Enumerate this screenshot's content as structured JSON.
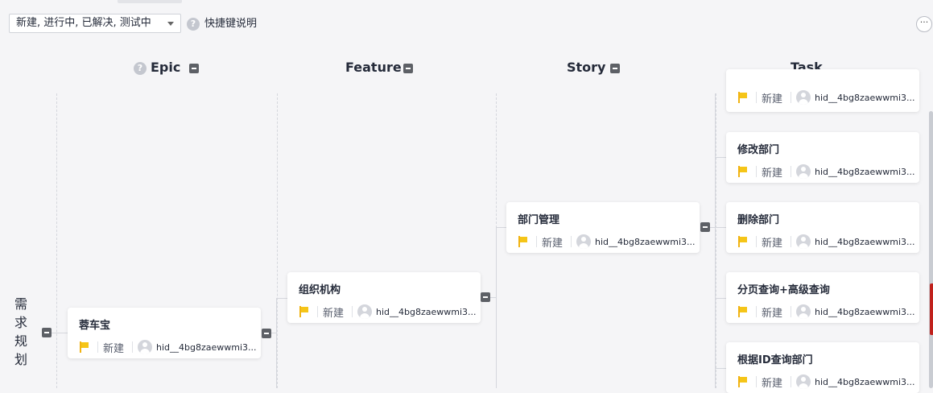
{
  "filter": {
    "value": "新建, 进行中, 已解决, 测试中"
  },
  "shortcut": {
    "label": "快捷键说明"
  },
  "icons": {
    "help": "?",
    "more": "···"
  },
  "columns": [
    {
      "name": "Epic"
    },
    {
      "name": "Feature"
    },
    {
      "name": "Story"
    },
    {
      "name": "Task"
    }
  ],
  "lane": {
    "label": "需求规划"
  },
  "cards": {
    "epic": {
      "title": "蓉车宝",
      "status": "新建",
      "user": "hid__4bg8zaewwmi3..."
    },
    "feature": {
      "title": "组织机构",
      "status": "新建",
      "user": "hid__4bg8zaewwmi3..."
    },
    "story": {
      "title": "部门管理",
      "status": "新建",
      "user": "hid__4bg8zaewwmi3..."
    },
    "tasks": [
      {
        "title": "",
        "status": "新建",
        "user": "hid__4bg8zaewwmi3..."
      },
      {
        "title": "修改部门",
        "status": "新建",
        "user": "hid__4bg8zaewwmi3..."
      },
      {
        "title": "删除部门",
        "status": "新建",
        "user": "hid__4bg8zaewwmi3..."
      },
      {
        "title": "分页查询+高级查询",
        "status": "新建",
        "user": "hid__4bg8zaewwmi3..."
      },
      {
        "title": "根据ID查询部门",
        "status": "新建",
        "user": "hid__4bg8zaewwmi3..."
      }
    ]
  },
  "colors": {
    "flag": "#f5c518",
    "accent_red": "#c0211c",
    "background": "#f5f5f7"
  }
}
